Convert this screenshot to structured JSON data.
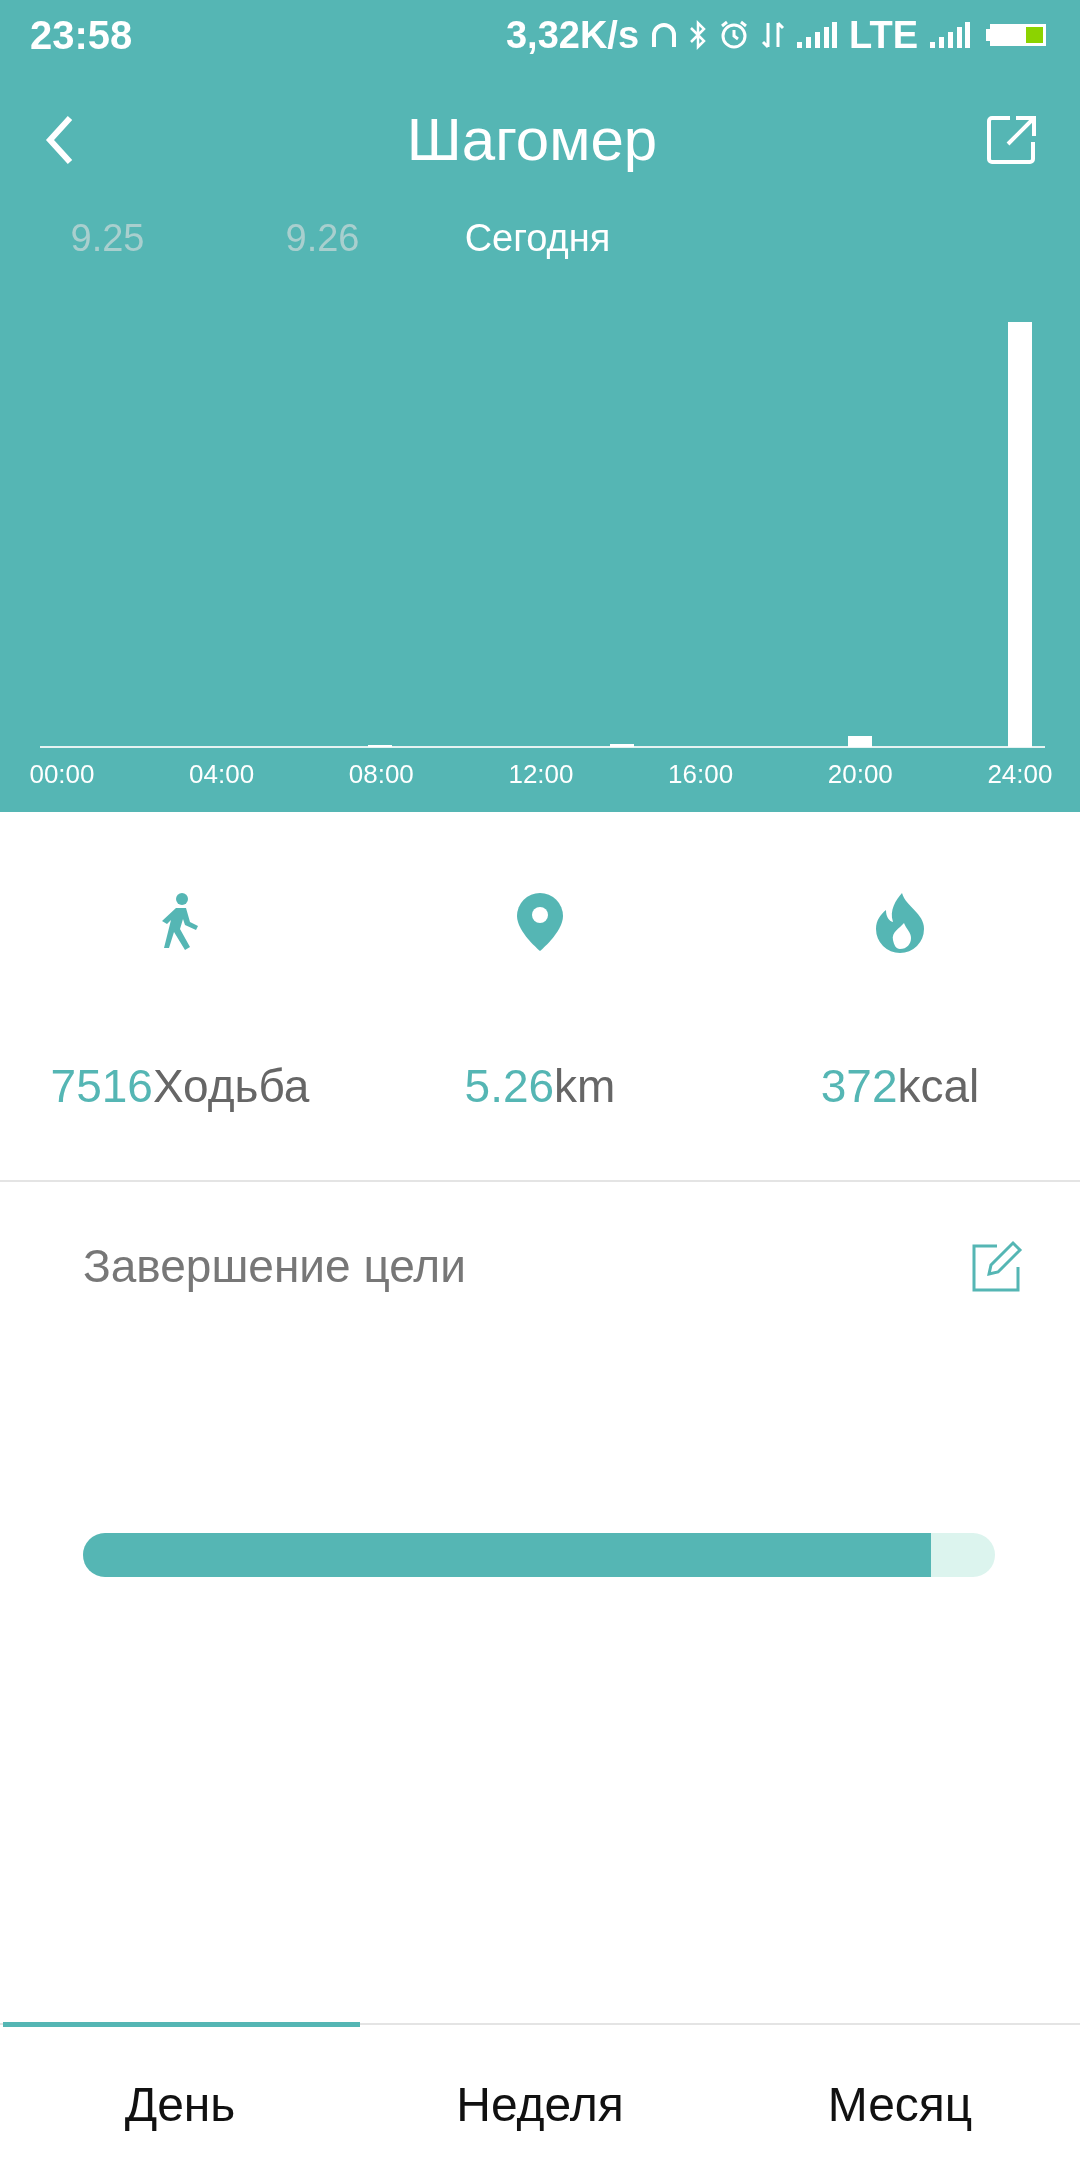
{
  "status_bar": {
    "time": "23:58",
    "speed": "3,32K/s",
    "network": "LTE"
  },
  "header": {
    "title": "Шагомер"
  },
  "date_tabs": [
    {
      "label": "9.25",
      "selected": false
    },
    {
      "label": "9.26",
      "selected": false
    },
    {
      "label": "Сегодня",
      "selected": true
    }
  ],
  "chart": {
    "x_labels": [
      "00:00",
      "04:00",
      "08:00",
      "12:00",
      "16:00",
      "20:00",
      "24:00"
    ]
  },
  "stats": [
    {
      "kind": "walk",
      "value": "7516",
      "unit": "Ходьба"
    },
    {
      "kind": "pin",
      "value": "5.26",
      "unit": "km"
    },
    {
      "kind": "flame",
      "value": "372",
      "unit": "kcal"
    }
  ],
  "goal": {
    "title": "Завершение цели",
    "level": 0.93
  },
  "bottom_tabs": [
    {
      "label": "День",
      "selected": true
    },
    {
      "label": "Неделя",
      "selected": false
    },
    {
      "label": "Месяц",
      "selected": false
    }
  ]
}
